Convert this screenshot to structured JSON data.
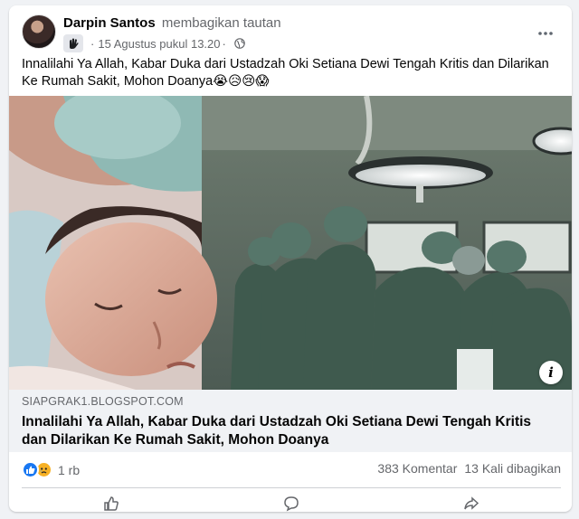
{
  "post": {
    "author": "Darpin Santos",
    "action": "membagikan tautan",
    "date": "15 Agustus pukul 13.20",
    "separator": "·",
    "caption": "Innalilahi Ya Allah, Kabar Duka dari Ustadzah Oki Setiana Dewi Tengah Kritis dan Dilarikan Ke Rumah Sakit, Mohon Doanya😭😥😢😱"
  },
  "link": {
    "domain": "SIAPGRAK1.BLOGSPOT.COM",
    "title": "Innalilahi Ya Allah, Kabar Duka dari Ustadzah Oki Setiana Dewi Tengah Kritis dan Dilarikan Ke Rumah Sakit, Mohon Doanya",
    "info_glyph": "i"
  },
  "stats": {
    "reactions_count": "1 rb",
    "comments": "383 Komentar",
    "shares": "13 Kali dibagikan"
  },
  "icons": {
    "more": "more-options-icon",
    "privacy": "globe-icon",
    "group": "group-badge-icon",
    "reactions": [
      "like-reaction-icon",
      "sad-reaction-icon"
    ]
  },
  "colors": {
    "accent": "#1877f2",
    "secondary_text": "#65676b",
    "link_bg": "#f0f2f5",
    "scrub_green": "#3f5a4e"
  }
}
